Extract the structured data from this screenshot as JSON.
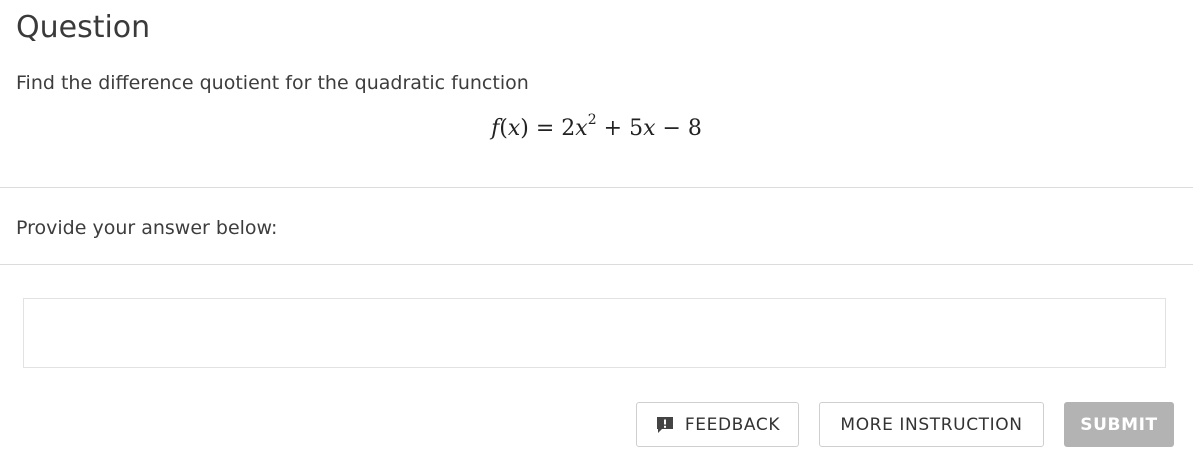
{
  "question": {
    "title": "Question",
    "prompt": "Find the difference quotient for the quadratic function",
    "equation": {
      "lhs": "f",
      "paren_open": "(",
      "var": "x",
      "paren_close": ")",
      "equals": "=",
      "coef1": "2",
      "var2": "x",
      "exponent": "2",
      "plus": "+",
      "coef2": "5",
      "var3": "x",
      "minus": "−",
      "constant": "8"
    }
  },
  "answer": {
    "label": "Provide your answer below:",
    "value": ""
  },
  "buttons": {
    "feedback": "FEEDBACK",
    "more_instruction": "MORE INSTRUCTION",
    "submit": "SUBMIT"
  },
  "colors": {
    "submit_bg": "#b3b3b3",
    "divider": "#dcdcdc"
  },
  "icons": {
    "feedback": "feedback-chat-icon"
  }
}
